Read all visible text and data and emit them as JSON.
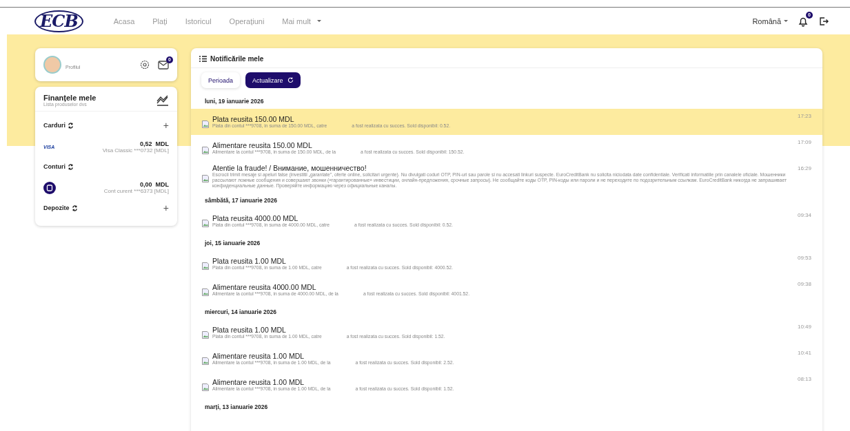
{
  "nav": {
    "logo": "ECB",
    "links": [
      {
        "label": "Acasa",
        "selected": false
      },
      {
        "label": "Plați",
        "selected": false
      },
      {
        "label": "Istoricul",
        "selected": false
      },
      {
        "label": "Operațiuni",
        "selected": false
      },
      {
        "label": "Mai mult",
        "selected": false,
        "dropdown": true
      }
    ],
    "language": "Română",
    "bell_badge": "0"
  },
  "profile": {
    "label": "Profilul",
    "mail_badge": "0"
  },
  "finances": {
    "title": "Finanțele mele",
    "subtitle": "Lista produselor dvs",
    "sections": [
      {
        "label": "Carduri",
        "add_button": "+",
        "items": [
          {
            "kind": "card",
            "logo": "VISA",
            "amount": "0,52  MDL",
            "name": "Visa Classic ***0732 [MDL]"
          }
        ]
      },
      {
        "label": "Conturi",
        "items": [
          {
            "kind": "account",
            "amount": "0,00  MDL",
            "name": "Cont curent ***6373 [MDL]"
          }
        ]
      },
      {
        "label": "Depozite",
        "add_button": "+"
      }
    ]
  },
  "notifications": {
    "title": "Notificările mele",
    "period_button": "Perioada",
    "refresh_button": "Actualizare",
    "days": [
      {
        "date": "luni, 19 ianuarie 2026",
        "items": [
          {
            "title": "Plata reusita 150.00 MDL",
            "body": [
              "Plata din contul ***9708, in suma de 150.00 MDL, catre",
              "a fost realizata cu succes. Sold disponibil: 0.52."
            ],
            "time": "17:23",
            "highlighted": true
          },
          {
            "title": "Alimentare reusita 150.00 MDL",
            "body": [
              "Alimentare la contul ***9708, in suma de 150.00 MDL, de la",
              "a fost realizata cu succes. Sold disponibil: 150.52."
            ],
            "time": "17:09",
            "highlighted": false
          },
          {
            "title": "Atentie la fraude! / Внимание, мошенничество!",
            "body": [
              "Escrocii trimit mesaje si apeluri false (investitii „garantate\", oferte online, solicitari urgente). Nu divulgati coduri OTP, PIN-uri sau parole si nu accesati linkuri suspecte. EuroCreditBank nu solicita niciodata date confidentiale. Verificati informatiile prin canalele oficiale. Мошенники рассылают ложные сообщения и совершают звонки («гарантированные» инвестиции, онлайн-предложения, срочные запросы). Не сообщайте коды OTP, PIN-коды или пароли и не переходите по подозрительным ссылкам. EuroCreditBank никогда не запрашивает конфиденциальные данные. Проверяйте информацию через официальные каналы."
            ],
            "time": "16:29",
            "highlighted": false
          }
        ]
      },
      {
        "date": "sâmbătă, 17 ianuarie 2026",
        "items": [
          {
            "title": "Plata reusita 4000.00 MDL",
            "body": [
              "Plata din contul ***9708, in suma de 4000.00 MDL, catre",
              "a fost realizata cu succes. Sold disponibil: 0.52."
            ],
            "time": "09:34",
            "highlighted": false
          }
        ]
      },
      {
        "date": "joi, 15 ianuarie 2026",
        "items": [
          {
            "title": "Plata reusita 1.00 MDL",
            "body": [
              "Plata din contul ***9708, in suma de 1.00 MDL, catre",
              "a fost realizata cu succes. Sold disponibil: 4000.52."
            ],
            "time": "09:53",
            "highlighted": false
          },
          {
            "title": "Alimentare reusita 4000.00 MDL",
            "body": [
              "Alimentare la contul ***9708, in suma de 4000.00 MDL, de la",
              "a fost realizata cu succes. Sold disponibil: 4001.52."
            ],
            "time": "09:38",
            "highlighted": false
          }
        ]
      },
      {
        "date": "miercuri, 14 ianuarie 2026",
        "items": [
          {
            "title": "Plata reusita 1.00 MDL",
            "body": [
              "Plata din contul ***9708, in suma de 1.00 MDL, catre",
              "a fost realizata cu succes. Sold disponibil: 1.52."
            ],
            "time": "10:49",
            "highlighted": false
          },
          {
            "title": "Alimentare reusita 1.00 MDL",
            "body": [
              "Alimentare la contul ***9708, in suma de 1.00 MDL, de la",
              "a fost realizata cu succes. Sold disponibil: 2.52."
            ],
            "time": "10:41",
            "highlighted": false
          },
          {
            "title": "Alimentare reusita 1.00 MDL",
            "body": [
              "Alimentare la contul ***9708, in suma de 1.00 MDL, de la",
              "a fost realizata cu succes. Sold disponibil: 1.52."
            ],
            "time": "08:13",
            "highlighted": false
          }
        ]
      },
      {
        "date": "marți, 13 ianuarie 2026"
      }
    ]
  }
}
